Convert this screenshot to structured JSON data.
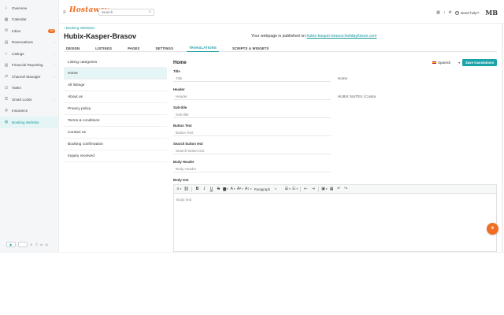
{
  "sidebar": {
    "items": [
      {
        "label": "Overview",
        "icon": "overview-icon",
        "glyph": "⌂",
        "chevron": ""
      },
      {
        "label": "Calendar",
        "icon": "calendar-icon",
        "glyph": "▦",
        "chevron": ""
      },
      {
        "label": "Inbox",
        "icon": "inbox-icon",
        "glyph": "✉",
        "chevron": "",
        "badge": "99"
      },
      {
        "label": "Reservations",
        "icon": "reservations-icon",
        "glyph": "▤",
        "chevron": "›"
      },
      {
        "label": "Listings",
        "icon": "listings-icon",
        "glyph": "⌂",
        "chevron": "›"
      },
      {
        "label": "Financial Reporting",
        "icon": "financial-reporting-icon",
        "glyph": "▥",
        "chevron": "›"
      },
      {
        "label": "Channel Manager",
        "icon": "channel-manager-icon",
        "glyph": "⇄",
        "chevron": "›"
      },
      {
        "label": "Tasks",
        "icon": "tasks-icon",
        "glyph": "☑",
        "chevron": ""
      },
      {
        "label": "Smart Locks",
        "icon": "smart-locks-icon",
        "glyph": "⚿",
        "chevron": "›"
      },
      {
        "label": "Insurance",
        "icon": "insurance-icon",
        "glyph": "⛨",
        "chevron": ""
      },
      {
        "label": "Booking Website",
        "icon": "booking-website-icon",
        "glyph": "◍",
        "chevron": "",
        "active": true
      }
    ]
  },
  "topbar": {
    "logo": "Hostaway",
    "search_placeholder": "Search",
    "help_label": "Need help?",
    "avatar_initials": "MB"
  },
  "breadcrumb": "Booking Websites",
  "page_title": "Hubix-Kasper-Brasov",
  "published": {
    "prefix": "Your webpage is published on",
    "url": "hubix-kasper-brasov.holidayfuture.com"
  },
  "tabs": [
    "DESIGN",
    "LISTINGS",
    "PAGES",
    "SETTINGS",
    "TRANSLATIONS",
    "SCRIPTS & WIDGETS"
  ],
  "active_tab": "TRANSLATIONS",
  "pages_list": [
    "Listing categories",
    "Home",
    "All listings",
    "About us",
    "Privacy policy",
    "Terms & conditions",
    "Contact us",
    "Booking confirmation",
    "Inquiry received"
  ],
  "selected_page": "Home",
  "form": {
    "title": "Home",
    "language": "Spanish",
    "save_label": "Save translations",
    "fields": [
      {
        "label": "Title",
        "placeholder": "Title",
        "reference": "Home"
      },
      {
        "label": "Header",
        "placeholder": "Header",
        "reference": "HUBIX SUITES | Contor"
      },
      {
        "label": "Sub-title",
        "placeholder": "Sub-title",
        "reference": ""
      },
      {
        "label": "Button Text",
        "placeholder": "Button Text",
        "reference": ""
      },
      {
        "label": "Search button text",
        "placeholder": "Search button text",
        "reference": ""
      },
      {
        "label": "Body Header",
        "placeholder": "Body Header",
        "reference": ""
      }
    ],
    "body_label": "Body text",
    "body_placeholder": "Body text",
    "paragraph_style": "Paragraph"
  },
  "colors": {
    "accent": "#1aa3a8",
    "brand": "#f26d21",
    "active_bg": "#e5f4f4"
  }
}
